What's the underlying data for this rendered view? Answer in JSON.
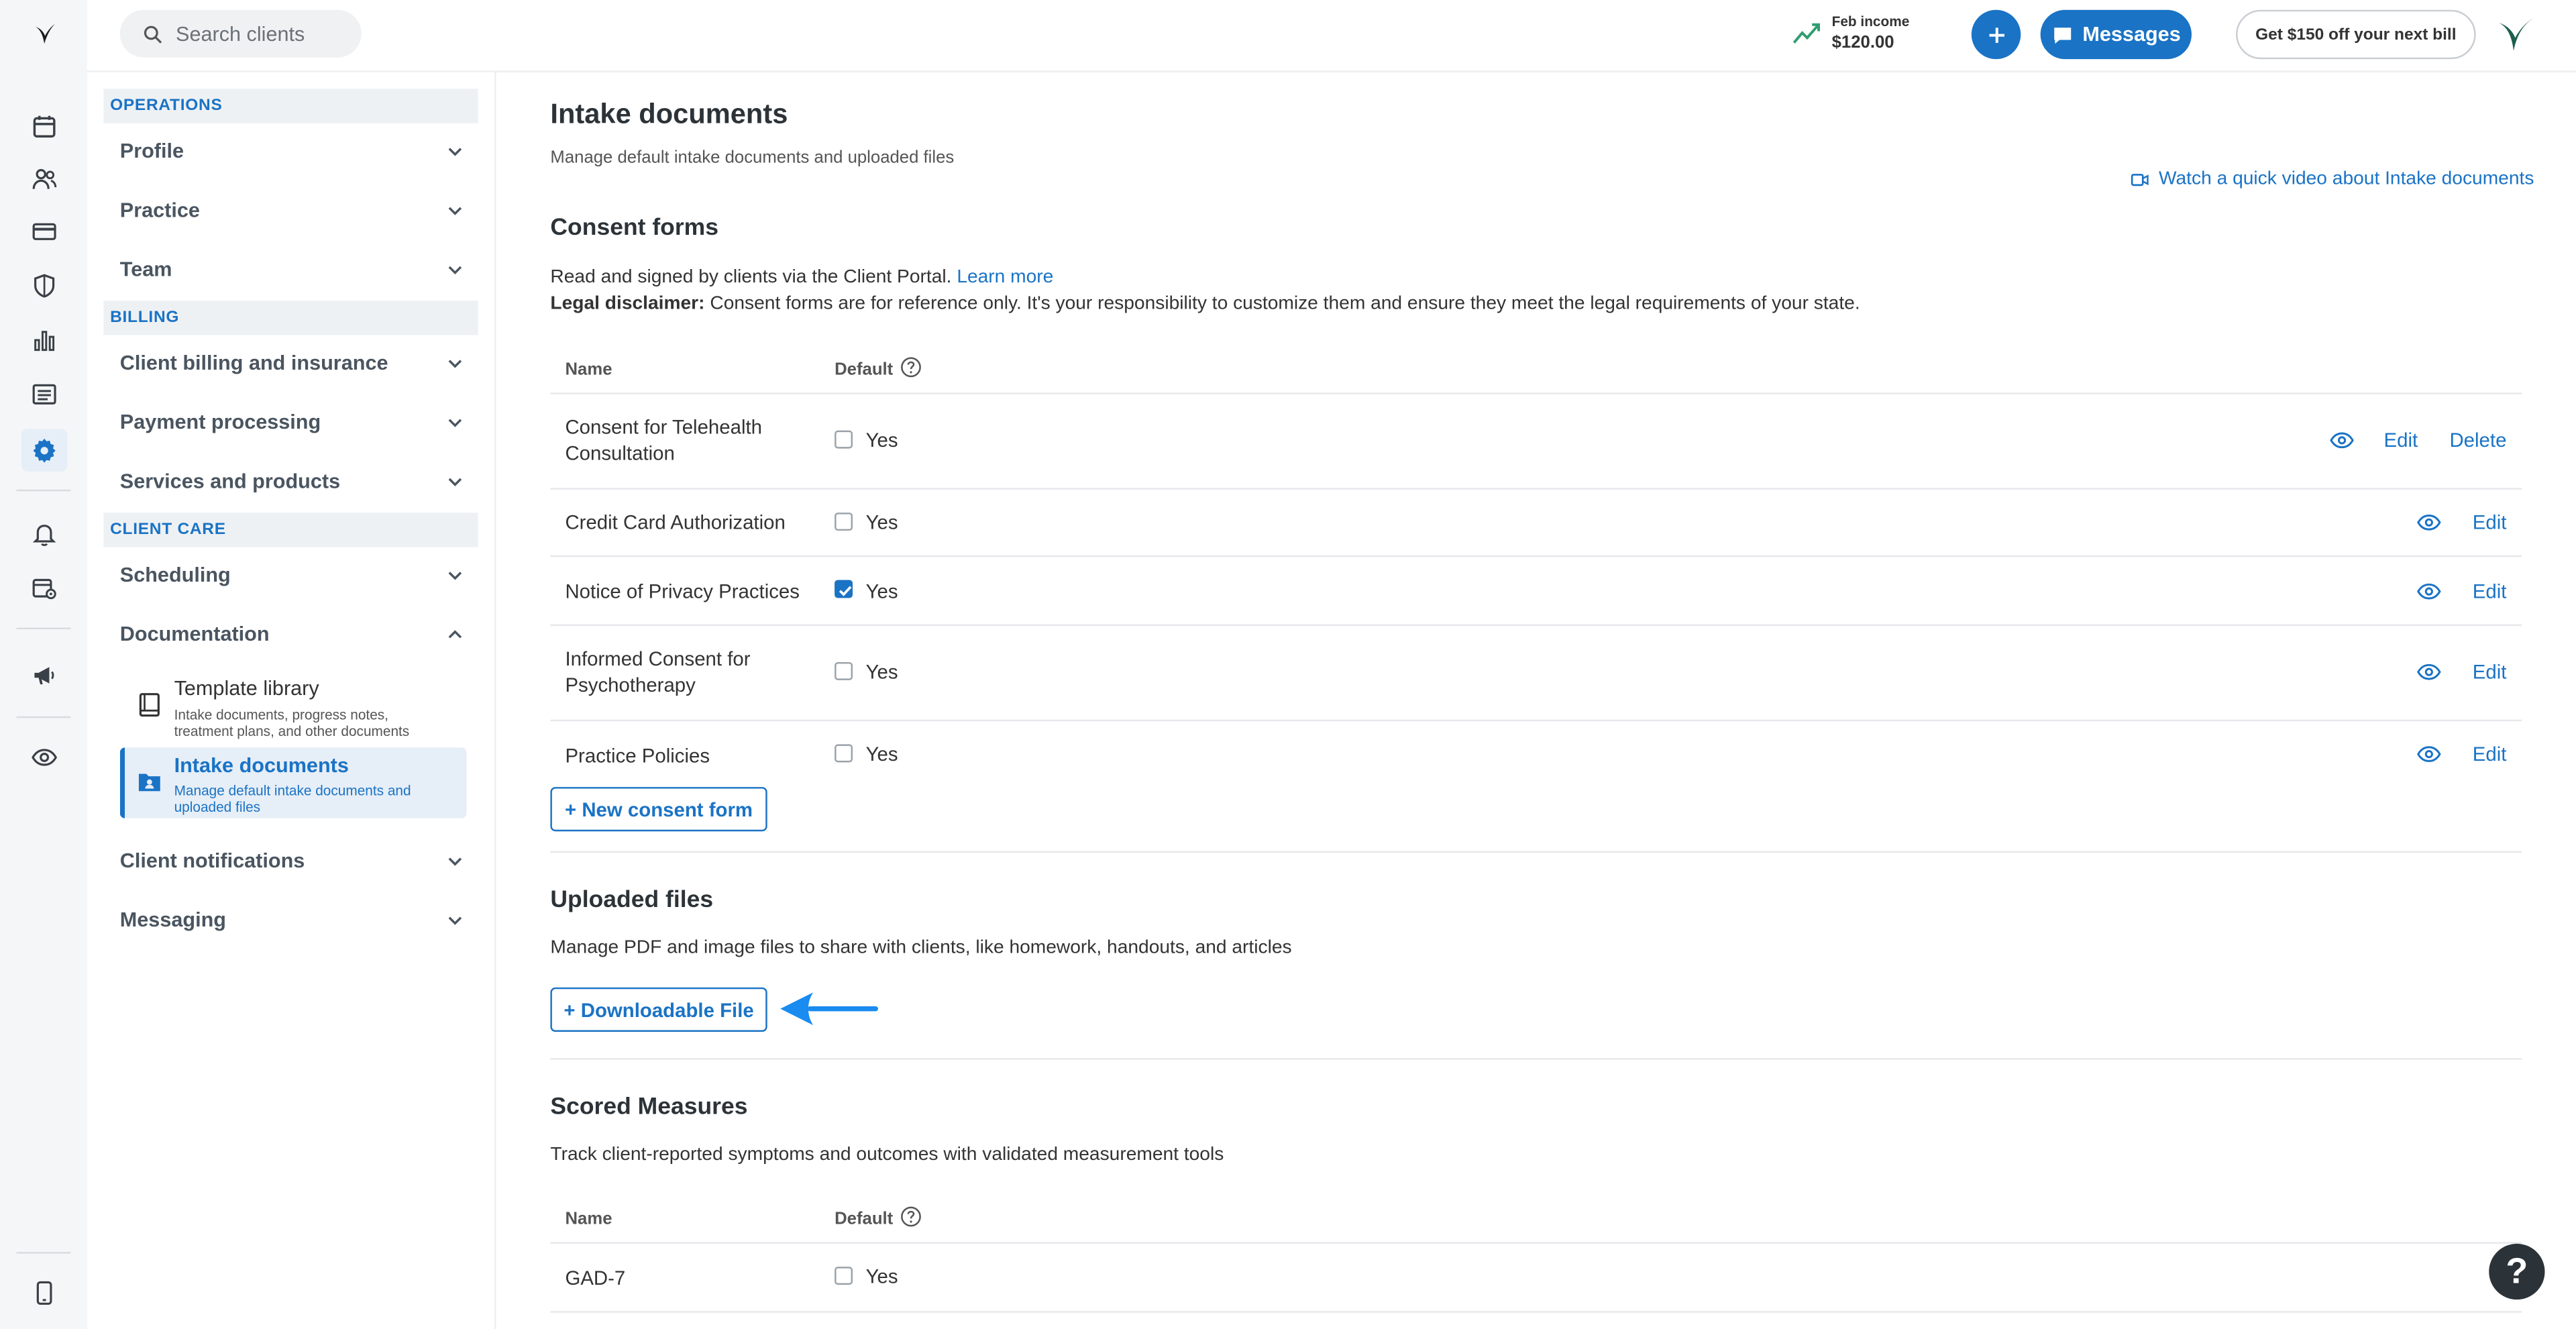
{
  "topbar": {
    "search_placeholder": "Search clients",
    "income_label": "Feb income",
    "income_value": "$120.00",
    "messages_label": "Messages",
    "promo_label": "Get $150 off your next bill"
  },
  "sidebar": {
    "sections": [
      {
        "header": "OPERATIONS",
        "items": [
          "Profile",
          "Practice",
          "Team"
        ]
      },
      {
        "header": "BILLING",
        "items": [
          "Client billing and insurance",
          "Payment processing",
          "Services and products"
        ]
      },
      {
        "header": "CLIENT CARE",
        "items": [
          "Scheduling",
          "Documentation",
          "Client notifications",
          "Messaging"
        ]
      }
    ],
    "documentation_sub": [
      {
        "title": "Template library",
        "desc": "Intake documents, progress notes, treatment plans, and other documents"
      },
      {
        "title": "Intake documents",
        "desc": "Manage default intake documents and uploaded files"
      }
    ]
  },
  "page": {
    "title": "Intake documents",
    "subtitle": "Manage default intake documents and uploaded files",
    "video_link": "Watch a quick video about Intake documents"
  },
  "consent": {
    "title": "Consent forms",
    "desc": "Read and signed by clients via the Client Portal.",
    "learn_more": "Learn more",
    "disclaimer_label": "Legal disclaimer:",
    "disclaimer_text": "Consent forms are for reference only. It's your responsibility to customize them and ensure they meet the legal requirements of your state.",
    "col_name": "Name",
    "col_default": "Default",
    "yes_label": "Yes",
    "edit_label": "Edit",
    "delete_label": "Delete",
    "rows": [
      {
        "name": "Consent for Telehealth Consultation",
        "checked": false
      },
      {
        "name": "Credit Card Authorization",
        "checked": false
      },
      {
        "name": "Notice of Privacy Practices",
        "checked": true
      },
      {
        "name": "Informed Consent for Psychotherapy",
        "checked": false
      },
      {
        "name": "Practice Policies",
        "checked": false
      }
    ],
    "new_button": "+ New consent form"
  },
  "uploaded": {
    "title": "Uploaded files",
    "desc": "Manage PDF and image files to share with clients, like homework, handouts, and articles",
    "button": "+ Downloadable File"
  },
  "scored": {
    "title": "Scored Measures",
    "desc": "Track client-reported symptoms and outcomes with validated measurement tools",
    "col_name": "Name",
    "col_default": "Default",
    "rows": [
      {
        "name": "GAD-7",
        "checked": false
      }
    ]
  },
  "help_label": "?",
  "colors": {
    "accent": "#1a73c5",
    "brand": "#1d5e4e"
  }
}
